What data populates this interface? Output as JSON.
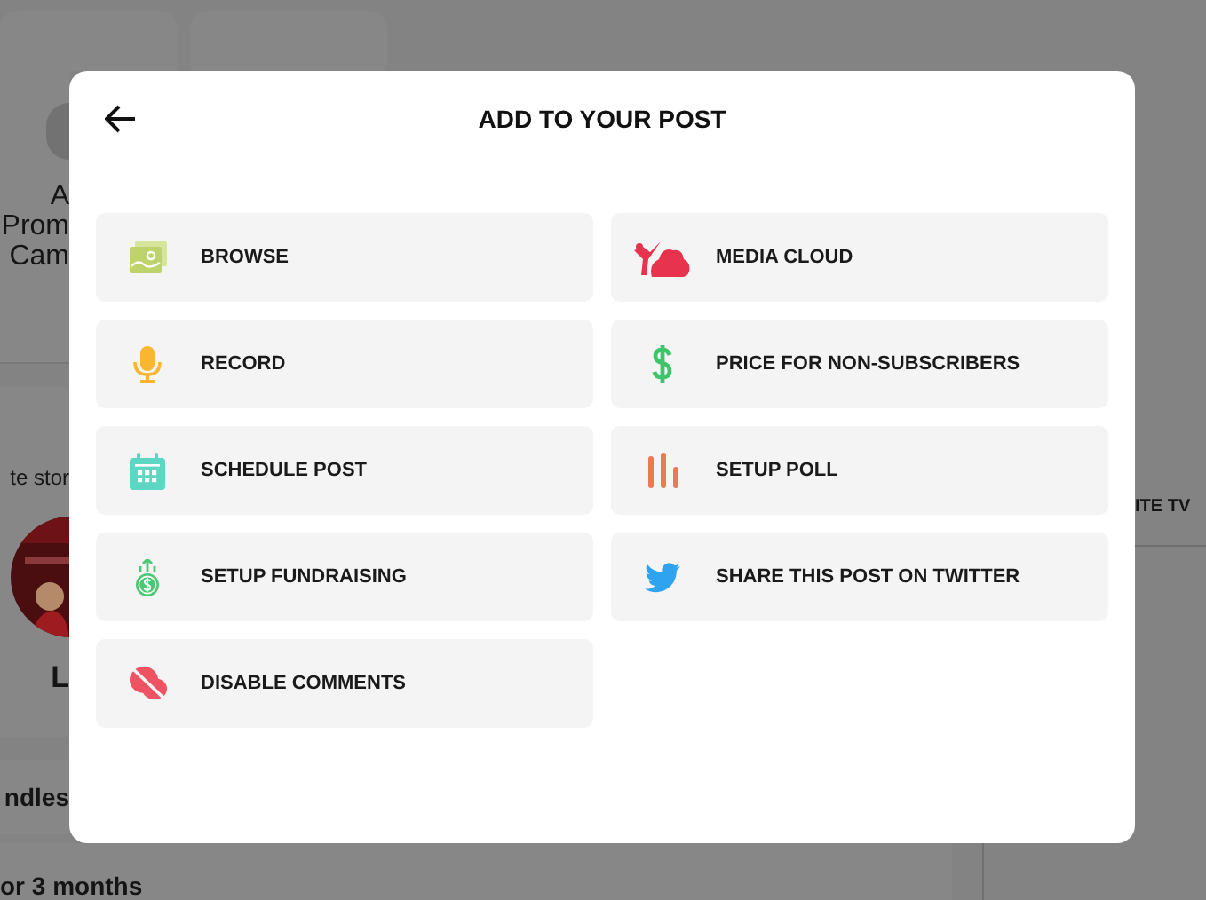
{
  "background": {
    "card_lines": [
      "A",
      "Prom",
      "Cam"
    ],
    "stories_label": "te stor",
    "story_name": "L",
    "bundles_heading": "ndles",
    "bundle_note": "or 3 months",
    "side_heading": "ITE TV"
  },
  "modal": {
    "title": "ADD TO YOUR POST",
    "options": [
      {
        "kind": "browse",
        "label": "BROWSE"
      },
      {
        "kind": "media_cloud",
        "label": "MEDIA CLOUD"
      },
      {
        "kind": "record",
        "label": "RECORD"
      },
      {
        "kind": "price",
        "label": "PRICE FOR NON-SUBSCRIBERS"
      },
      {
        "kind": "schedule",
        "label": "SCHEDULE POST"
      },
      {
        "kind": "poll",
        "label": "SETUP POLL"
      },
      {
        "kind": "fundraising",
        "label": "SETUP FUNDRAISING"
      },
      {
        "kind": "twitter",
        "label": "SHARE THIS POST ON TWITTER"
      },
      {
        "kind": "disable_comments",
        "label": "DISABLE COMMENTS"
      }
    ]
  }
}
